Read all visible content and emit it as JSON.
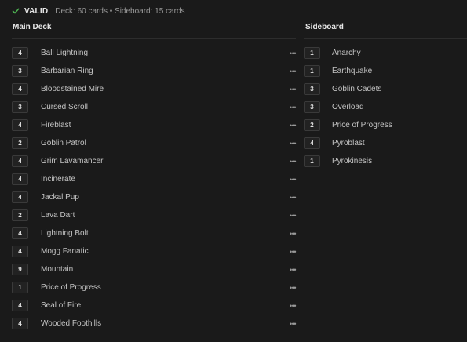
{
  "status": {
    "valid_label": "VALID",
    "summary": "Deck: 60 cards • Sideboard: 15 cards",
    "check_color": "#4caf50",
    "check_icon": "check-icon"
  },
  "main_deck": {
    "title": "Main Deck",
    "more_icon": "ellipsis-icon",
    "cards": [
      {
        "qty": "4",
        "name": "Ball Lightning",
        "more": "•••"
      },
      {
        "qty": "3",
        "name": "Barbarian Ring",
        "more": "•••"
      },
      {
        "qty": "4",
        "name": "Bloodstained Mire",
        "more": "•••"
      },
      {
        "qty": "3",
        "name": "Cursed Scroll",
        "more": "•••"
      },
      {
        "qty": "4",
        "name": "Fireblast",
        "more": "•••"
      },
      {
        "qty": "2",
        "name": "Goblin Patrol",
        "more": "•••"
      },
      {
        "qty": "4",
        "name": "Grim Lavamancer",
        "more": "•••"
      },
      {
        "qty": "4",
        "name": "Incinerate",
        "more": "•••"
      },
      {
        "qty": "4",
        "name": "Jackal Pup",
        "more": "•••"
      },
      {
        "qty": "2",
        "name": "Lava Dart",
        "more": "•••"
      },
      {
        "qty": "4",
        "name": "Lightning Bolt",
        "more": "•••"
      },
      {
        "qty": "4",
        "name": "Mogg Fanatic",
        "more": "•••"
      },
      {
        "qty": "9",
        "name": "Mountain",
        "more": "•••"
      },
      {
        "qty": "1",
        "name": "Price of Progress",
        "more": "•••"
      },
      {
        "qty": "4",
        "name": "Seal of Fire",
        "more": "•••"
      },
      {
        "qty": "4",
        "name": "Wooded Foothills",
        "more": "•••"
      }
    ]
  },
  "sideboard": {
    "title": "Sideboard",
    "cards": [
      {
        "qty": "1",
        "name": "Anarchy"
      },
      {
        "qty": "1",
        "name": "Earthquake"
      },
      {
        "qty": "3",
        "name": "Goblin Cadets"
      },
      {
        "qty": "3",
        "name": "Overload"
      },
      {
        "qty": "2",
        "name": "Price of Progress"
      },
      {
        "qty": "4",
        "name": "Pyroblast"
      },
      {
        "qty": "1",
        "name": "Pyrokinesis"
      }
    ]
  }
}
